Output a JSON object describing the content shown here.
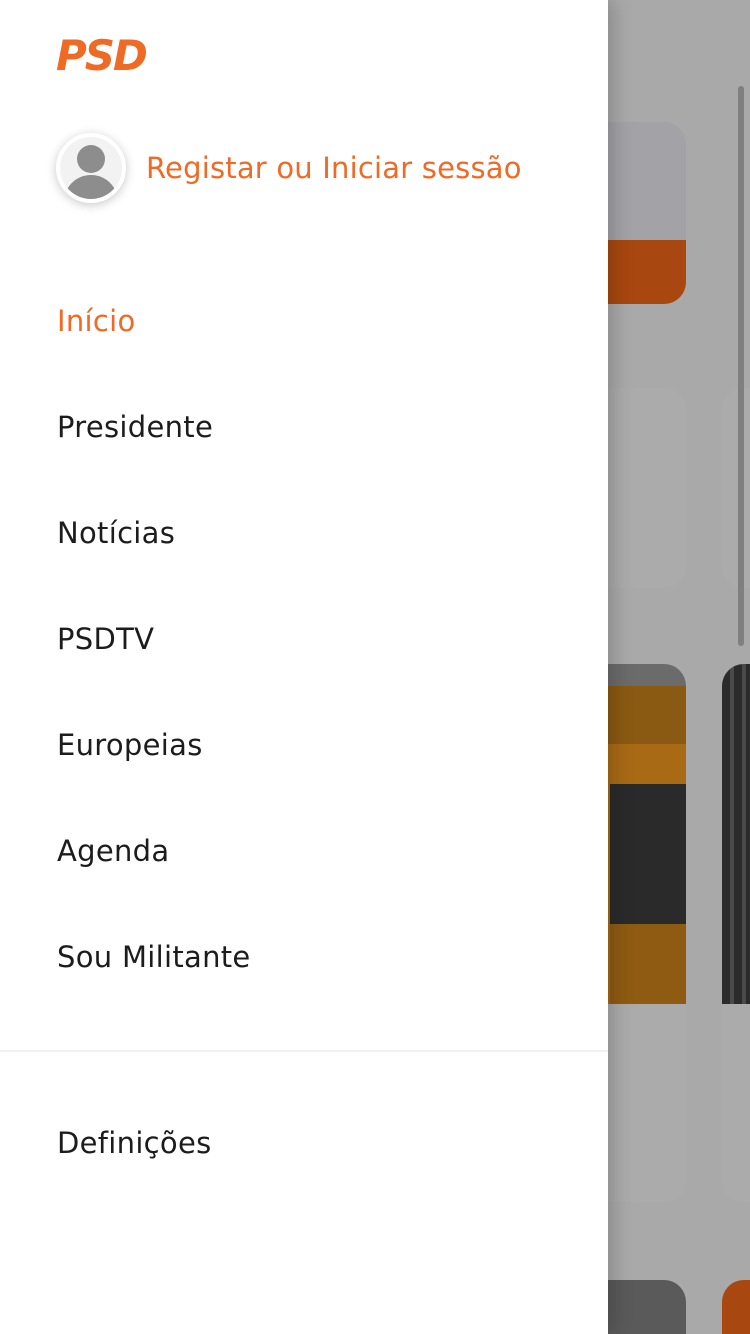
{
  "brand": {
    "logo_text": "PSD",
    "accent_color": "#ef6a24"
  },
  "account": {
    "label": "Registar ou Iniciar sessão",
    "avatar_icon": "user-avatar-icon"
  },
  "menu": {
    "items": [
      {
        "label": "Início",
        "active": true
      },
      {
        "label": "Presidente",
        "active": false
      },
      {
        "label": "Notícias",
        "active": false
      },
      {
        "label": "PSDTV",
        "active": false
      },
      {
        "label": "Europeias",
        "active": false
      },
      {
        "label": "Agenda",
        "active": false
      },
      {
        "label": "Sou Militante",
        "active": false
      }
    ]
  },
  "footer": {
    "settings_label": "Definições"
  }
}
